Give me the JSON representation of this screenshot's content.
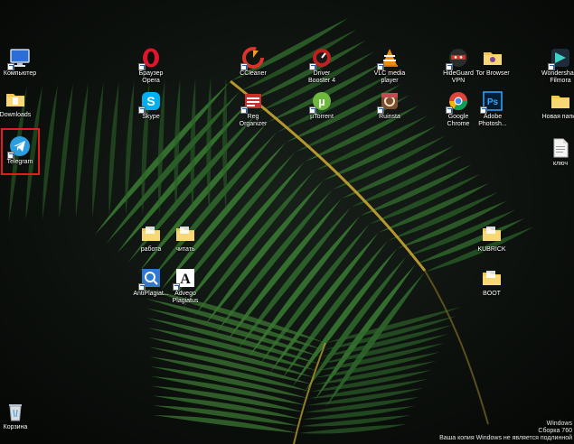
{
  "desktop": {
    "icons": [
      {
        "id": "computer",
        "label": "Компьютер",
        "icon": "computer-icon"
      },
      {
        "id": "downloads",
        "label": "Downloads",
        "icon": "folder-icon"
      },
      {
        "id": "telegram",
        "label": "Telegram",
        "icon": "telegram-icon"
      },
      {
        "id": "opera",
        "label": "Браузер\nOpera",
        "icon": "opera-icon"
      },
      {
        "id": "skype",
        "label": "Skype",
        "icon": "skype-icon"
      },
      {
        "id": "ccleaner",
        "label": "CCleaner",
        "icon": "ccleaner-icon"
      },
      {
        "id": "reg-organizer",
        "label": "Reg\nOrganizer",
        "icon": "reg-organizer-icon"
      },
      {
        "id": "driver-booster",
        "label": "Driver\nBooster 4",
        "icon": "driver-booster-icon"
      },
      {
        "id": "utorrent",
        "label": "µTorrent",
        "icon": "utorrent-icon"
      },
      {
        "id": "vlc",
        "label": "VLC media\nplayer",
        "icon": "vlc-icon"
      },
      {
        "id": "ruinsta",
        "label": "Ruinsta",
        "icon": "ruinsta-icon"
      },
      {
        "id": "hideguard",
        "label": "HideGuard\nVPN",
        "icon": "hideguard-icon"
      },
      {
        "id": "chrome",
        "label": "Google\nChrome",
        "icon": "chrome-icon"
      },
      {
        "id": "tor",
        "label": "Tor Browser",
        "icon": "tor-folder-icon"
      },
      {
        "id": "photoshop",
        "label": "Adobe\nPhotosh...",
        "icon": "photoshop-icon"
      },
      {
        "id": "filmora",
        "label": "Wondershare\nFilmora",
        "icon": "filmora-icon"
      },
      {
        "id": "new-folder",
        "label": "Новая папка",
        "icon": "folder-icon"
      },
      {
        "id": "kluch",
        "label": "ключ",
        "icon": "text-file-icon"
      },
      {
        "id": "rabota",
        "label": "работа",
        "icon": "folder-icon"
      },
      {
        "id": "chitat",
        "label": "читать",
        "icon": "folder-icon"
      },
      {
        "id": "antiplagiat",
        "label": "AntiPlagiat...",
        "icon": "antiplagiat-icon"
      },
      {
        "id": "advego",
        "label": "Advego\nPlagiatus",
        "icon": "advego-icon"
      },
      {
        "id": "kubrick",
        "label": "KUBRICK",
        "icon": "folder-icon"
      },
      {
        "id": "boot",
        "label": "BOOT",
        "icon": "folder-icon"
      },
      {
        "id": "recycle-bin",
        "label": "Корзина",
        "icon": "recycle-bin-icon"
      }
    ],
    "selected_icon": "telegram",
    "accent_selection_color": "#e31d1d"
  },
  "watermark": {
    "line1": "Windows",
    "line2": "Сборка 760",
    "line3": "Ваша копия Windows не является подлинной"
  }
}
